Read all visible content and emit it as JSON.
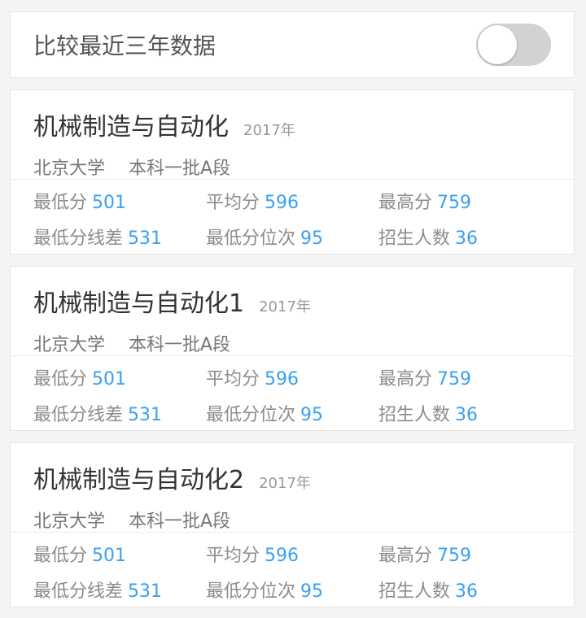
{
  "compare_toggle": {
    "label": "比较最近三年数据",
    "on": false
  },
  "stat_labels": {
    "min": "最低分",
    "avg": "平均分",
    "max": "最高分",
    "min_line_diff": "最低分线差",
    "min_rank": "最低分位次",
    "enroll": "招生人数"
  },
  "cards": [
    {
      "major": "机械制造与自动化",
      "year": "2017年",
      "school": "北京大学",
      "batch": "本科一批A段",
      "stats": {
        "min": "501",
        "avg": "596",
        "max": "759",
        "min_line_diff": "531",
        "min_rank": "95",
        "enroll": "36"
      }
    },
    {
      "major": "机械制造与自动化1",
      "year": "2017年",
      "school": "北京大学",
      "batch": "本科一批A段",
      "stats": {
        "min": "501",
        "avg": "596",
        "max": "759",
        "min_line_diff": "531",
        "min_rank": "95",
        "enroll": "36"
      }
    },
    {
      "major": "机械制造与自动化2",
      "year": "2017年",
      "school": "北京大学",
      "batch": "本科一批A段",
      "stats": {
        "min": "501",
        "avg": "596",
        "max": "759",
        "min_line_diff": "531",
        "min_rank": "95",
        "enroll": "36"
      }
    }
  ]
}
